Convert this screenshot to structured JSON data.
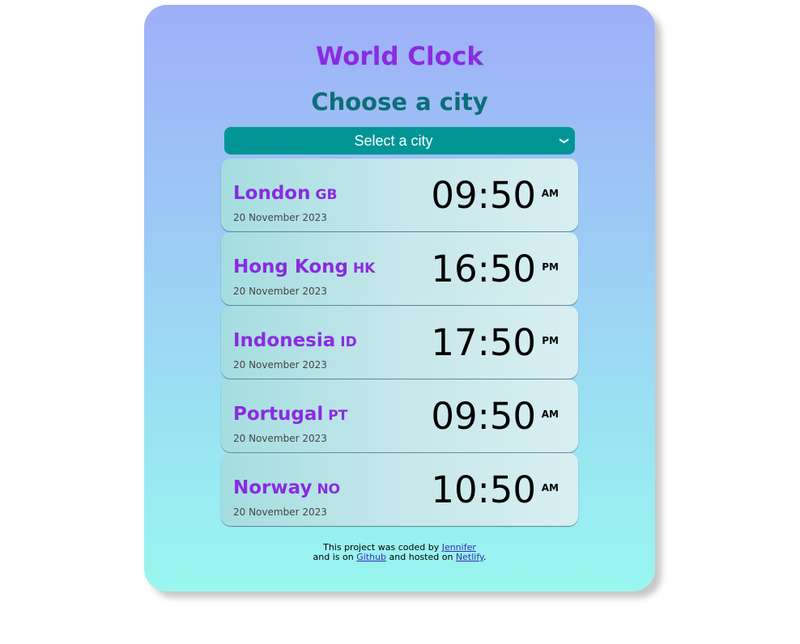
{
  "header": {
    "title": "World Clock",
    "subtitle": "Choose a city"
  },
  "city_select": {
    "selected": "Select a city",
    "icon": "chevron-down-icon"
  },
  "cities": [
    {
      "name": "London",
      "code": "GB",
      "date": "20 November 2023",
      "time": "09:50",
      "ampm": "AM"
    },
    {
      "name": "Hong Kong",
      "code": "HK",
      "date": "20 November 2023",
      "time": "16:50",
      "ampm": "PM"
    },
    {
      "name": "Indonesia",
      "code": "ID",
      "date": "20 November 2023",
      "time": "17:50",
      "ampm": "PM"
    },
    {
      "name": "Portugal",
      "code": "PT",
      "date": "20 November 2023",
      "time": "09:50",
      "ampm": "AM"
    },
    {
      "name": "Norway",
      "code": "NO",
      "date": "20 November 2023",
      "time": "10:50",
      "ampm": "AM"
    }
  ],
  "footer": {
    "line1_text": "This project was coded by ",
    "author_link": "Jennifer",
    "line2_text_a": "and is on ",
    "github_link": "Github",
    "line2_text_b": " and hosted on ",
    "netlify_link": "Netlify",
    "line2_text_c": "."
  },
  "colors": {
    "title": "#8a2be2",
    "subtitle": "#0d6e77",
    "select_bg": "#019695",
    "gradient_top": "#9eaff8",
    "gradient_bottom": "#99f7f0"
  }
}
